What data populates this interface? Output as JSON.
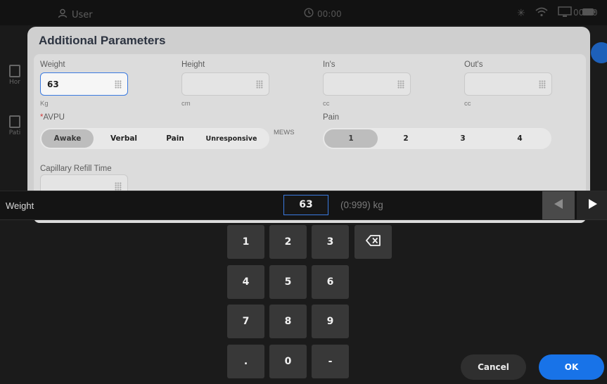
{
  "statusbar": {
    "user": "User",
    "clock": "00:00",
    "time_right": "00:00"
  },
  "sidebar": {
    "items": [
      {
        "label": "Hor",
        "icon": "home-icon"
      },
      {
        "label": "Pati",
        "icon": "patient-icon"
      }
    ]
  },
  "modal": {
    "title": "Additional Parameters",
    "fields": {
      "weight": {
        "label": "Weight",
        "value": "63",
        "unit": "Kg"
      },
      "height": {
        "label": "Height",
        "value": "",
        "unit": "cm"
      },
      "ins": {
        "label": "In's",
        "value": "",
        "unit": "cc"
      },
      "outs": {
        "label": "Out's",
        "value": "",
        "unit": "cc"
      },
      "capillary": {
        "label": "Capillary Refill Time",
        "value": ""
      }
    },
    "avpu": {
      "required_mark": "*",
      "label": "AVPU",
      "options": [
        "Awake",
        "Verbal",
        "Pain",
        "Unresponsive"
      ],
      "selected": "Awake",
      "mews": "MEWS"
    },
    "pain": {
      "label": "Pain",
      "options": [
        "1",
        "2",
        "3",
        "4"
      ],
      "selected": "1"
    }
  },
  "inputbar": {
    "label": "Weight",
    "value": "63",
    "range": "(0:999) kg"
  },
  "keypad": {
    "keys": [
      "1",
      "2",
      "3",
      "4",
      "5",
      "6",
      "7",
      "8",
      "9",
      ".",
      "0",
      "-"
    ],
    "backspace_icon": "backspace-icon"
  },
  "actions": {
    "cancel": "Cancel",
    "ok": "OK"
  },
  "colors": {
    "accent": "#1873e8",
    "focus_border": "#3a7ae0",
    "keypad_bg": "#1b1b1b",
    "key": "#383838",
    "modal": "#cfcfcf"
  }
}
